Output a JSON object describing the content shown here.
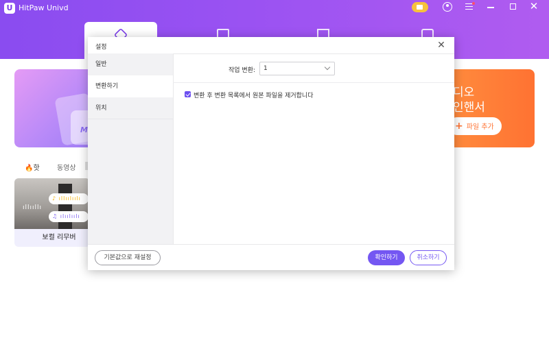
{
  "app": {
    "title": "HitPaw Univd",
    "logo_letter": "U"
  },
  "banner": {
    "left_label": "MP",
    "right_line1": "디오",
    "right_line2": "인핸서",
    "add_file": "파일 추가"
  },
  "categories": {
    "hot": "핫",
    "video": "동영상"
  },
  "feature_card": {
    "title": "보컬 리무버",
    "wave1": "♪ ıllıılıılı",
    "wave2": "♫ ılıılıılı",
    "wave_left": "ıllııllı"
  },
  "settings": {
    "title": "설정",
    "close": "✕",
    "sidebar": [
      {
        "label": "일반"
      },
      {
        "label": "변환하기"
      },
      {
        "label": "위치"
      }
    ],
    "task_label": "작업 변환:",
    "task_value": "1",
    "remove_after_convert": "변환 후 변환 목록에서 원본 파일을 제거합니다",
    "reset_button": "기본값으로 재설정",
    "ok_button": "확인하기",
    "cancel_button": "취소하기"
  },
  "colors": {
    "accent": "#7457f2",
    "header": "#9a52f2",
    "orange": "#ff7232"
  }
}
